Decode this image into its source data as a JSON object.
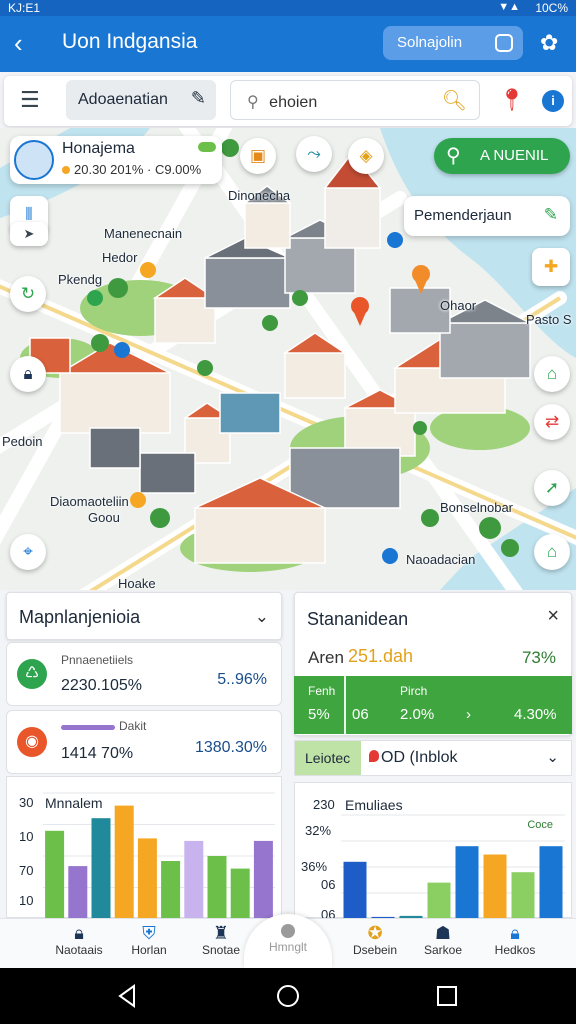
{
  "status": {
    "time": "KJ:E1",
    "signal": "▼▲",
    "battery": "10C%"
  },
  "app_bar": {
    "title": "Uon Indgansia",
    "search_label": "Solnajolin"
  },
  "toolbar": {
    "chip_label": "Adoaenatian",
    "search_placeholder": "ehoien"
  },
  "location_card": {
    "name": "Honajema",
    "subtitle": "20.30 201% · C9.00%"
  },
  "fab": {
    "label": "A NUENIL"
  },
  "place_card": {
    "label": "Pemenderjaun"
  },
  "map_labels": {
    "l1": "Dinonecha",
    "l2": "Manenecnain",
    "l3": "Hedor",
    "l4": "Pkendg",
    "l5": "Ohaor",
    "l6": "Pasto S",
    "l7": "Pedoin",
    "l8": "Diaomaoteliin",
    "l9": "Goou",
    "l10": "Bonselnobar",
    "l11": "Naoadacian",
    "l12": "Hoake"
  },
  "left_panel": {
    "title": "Mapnlanjenioia",
    "metric1": {
      "label": "Pnnaenetiiels",
      "value": "2230.105%",
      "pct": "5..96%"
    },
    "metric2": {
      "label": "Dakit",
      "value": "1414 70%",
      "pct": "1380.30%"
    },
    "chart_axis_labels": [
      "30",
      "10",
      "70",
      "10"
    ],
    "chart_title": "Mnnalem"
  },
  "right_panel": {
    "title": "Stananidean",
    "area_key": "Aren",
    "area_value": "251.dah",
    "area_pct": "73%",
    "band": [
      {
        "t1": "Fenh",
        "t2": "5%"
      },
      {
        "t1": "",
        "t2": "06"
      },
      {
        "t1": "Pirch",
        "t2": "2.0%"
      },
      {
        "t1": "",
        "t2": "4.30%"
      }
    ],
    "select_tag": "Leiotec",
    "select_value": "OD (Inblok",
    "chart_title": "Emuliaes",
    "chart_corner": "Coce",
    "chart_axis_labels": [
      "230",
      "32%",
      "36%",
      "06",
      "06"
    ]
  },
  "bottom_nav": {
    "items": [
      "Naotaais",
      "Horlan",
      "Snotae",
      "Dsebein",
      "Sarkoe",
      "Hedkos"
    ],
    "center": "Hmnglt"
  },
  "colors": {
    "primary": "#1976d2",
    "accent_green": "#2ea44f",
    "orange": "#f5a623",
    "teal": "#20899b",
    "purple": "#9575cd"
  },
  "chart_data": [
    {
      "type": "bar",
      "title": "Mnnalem",
      "series": [
        {
          "values": [
            70,
            42,
            80
          ]
        },
        {
          "values": [
            90,
            64,
            46,
            62
          ]
        },
        {
          "values": [
            50,
            40,
            62
          ]
        }
      ],
      "ytick_labels": [
        "30",
        "10",
        "70",
        "10"
      ]
    },
    {
      "type": "bar",
      "title": "Emuliaes",
      "series": [
        {
          "values": [
            55,
            2,
            3,
            35,
            70
          ]
        },
        {
          "values": [
            62,
            45,
            70
          ]
        }
      ],
      "ytick_labels": [
        "230",
        "32%",
        "36%",
        "06",
        "06"
      ]
    }
  ]
}
